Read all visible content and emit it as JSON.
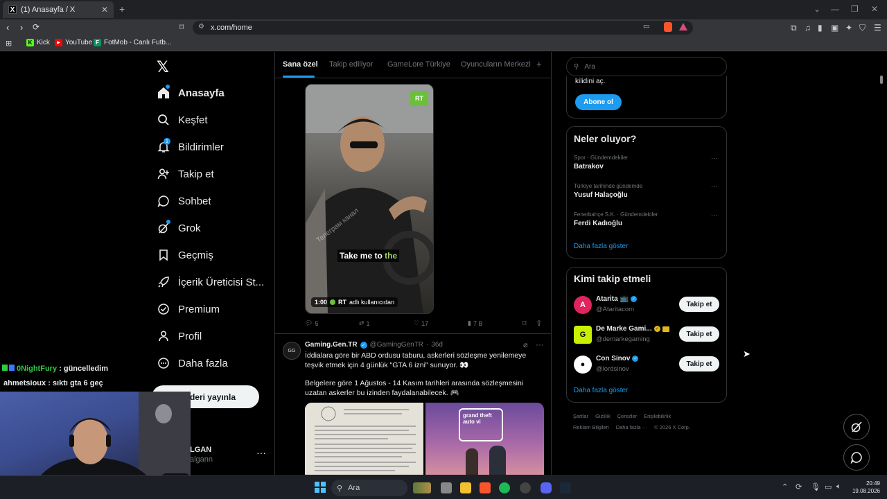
{
  "browser": {
    "tab_title": "(1) Anasayfa / X",
    "tab_icon": "x-logo-icon",
    "url": "x.com/home",
    "bookmarks": [
      {
        "label": "Kick",
        "icon": "kick-icon"
      },
      {
        "label": "YouTube",
        "icon": "youtube-icon"
      },
      {
        "label": "FotMob - Canlı Futb...",
        "icon": "fotmob-icon"
      }
    ]
  },
  "sidebar": {
    "items": [
      {
        "label": "Anasayfa",
        "icon": "home-icon"
      },
      {
        "label": "Keşfet",
        "icon": "search-icon"
      },
      {
        "label": "Bildirimler",
        "icon": "bell-icon",
        "badge": "1"
      },
      {
        "label": "Takip et",
        "icon": "person-add-icon"
      },
      {
        "label": "Sohbet",
        "icon": "chat-icon"
      },
      {
        "label": "Grok",
        "icon": "grok-icon"
      },
      {
        "label": "Geçmiş",
        "icon": "bookmark-icon"
      },
      {
        "label": "İçerik Üreticisi St...",
        "icon": "rocket-icon"
      },
      {
        "label": "Premium",
        "icon": "verified-icon"
      },
      {
        "label": "Profil",
        "icon": "person-icon"
      },
      {
        "label": "Daha fazla",
        "icon": "more-circle-icon"
      }
    ],
    "post_button": "...deri yayınla",
    "profile": {
      "name": "LGAN",
      "handle": "algann"
    }
  },
  "feed": {
    "tabs": [
      "Sana özel",
      "Takip ediliyor",
      "GameLore Türkiye",
      "Oyuncuların Merkezi"
    ],
    "active_tab": "Sana özel",
    "post1": {
      "video_caption_white": "Take me to",
      "video_caption_green": "the",
      "video_badge": "RT",
      "video_watermark": "Телеграм канал",
      "duration": "1:00",
      "source_account": "RT",
      "source_text": "adlı kullanıcıdan",
      "actions": {
        "replies": "5",
        "reposts": "1",
        "likes": "17",
        "views": "7 B"
      }
    },
    "post2": {
      "author": "Gaming.Gen.TR",
      "handle": "@GamingGenTR",
      "time": "36d",
      "text1": "İddialara göre bir ABD ordusu taburu, askerleri sözleşme yenilemeye teşvik etmek için 4 günlük \"GTA 6 izni\" sunuyor. 👀",
      "text2": "Belgelere göre 1 Ağustos - 14 Kasım tarihleri arasında sözleşmesini uzatan askerler bu izinden faydalanabilecek. 🎮",
      "image2_text": "Grand Theft Auto VI"
    }
  },
  "right": {
    "search_placeholder": "Ara",
    "premium_tail": "kilidini aç.",
    "subscribe_button": "Abone ol",
    "trends_title": "Neler oluyor?",
    "trends": [
      {
        "context": "Spor · Gündemdekiler",
        "name": "Batrakov"
      },
      {
        "context": "Türkiye tarihinde gündemde",
        "name": "Yusuf Halaçoğlu"
      },
      {
        "context": "Fenerbahçe S.K. · Gündemdekiler",
        "name": "Ferdi Kadıoğlu"
      }
    ],
    "trends_more": "Daha fazla göster",
    "who_title": "Kimi takip etmeli",
    "who": [
      {
        "name": "Atarita 📺",
        "handle": "@Ataritacom",
        "button": "Takip et",
        "avatar_color": "#e0245e"
      },
      {
        "name": "De Marke Gami...",
        "handle": "@demarkegaming",
        "button": "Takip et",
        "avatar_color": "#c8f000"
      },
      {
        "name": "Con Sinov",
        "handle": "@lordsinov",
        "button": "Takip et",
        "avatar_color": "#ffffff"
      }
    ],
    "who_more": "Daha fazla göster",
    "footer_row1": [
      "Şartlar",
      "Gizlilik",
      "Çerezler",
      "Erişilebilirlik"
    ],
    "footer_row2": [
      "Reklam Bilgileri",
      "Daha fazla ···",
      "© 2026 X Corp."
    ]
  },
  "chat": [
    {
      "user": "0NightFury",
      "msg": "güncelledim",
      "color": "#2ecc40"
    },
    {
      "user": "ahmetsioux",
      "msg": "sıktı gta 6 geç",
      "color": "#e7e9ea"
    }
  ],
  "taskbar": {
    "search": "Ara",
    "time": "20:49",
    "date": "19.08.2026"
  }
}
